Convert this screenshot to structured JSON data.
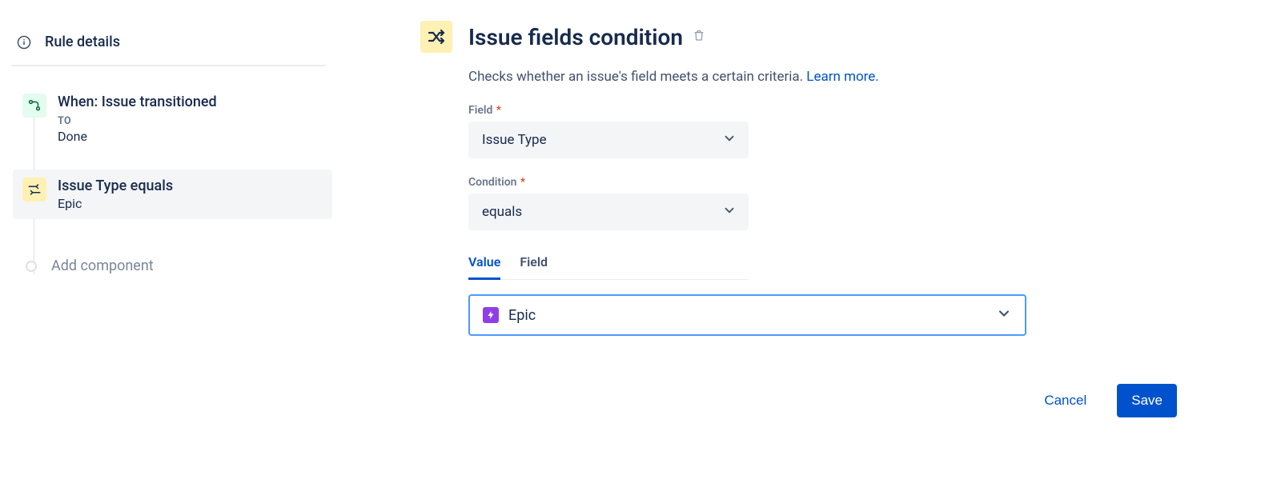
{
  "sidebar": {
    "rule_details_label": "Rule details",
    "steps": [
      {
        "title": "When: Issue transitioned",
        "sub_label": "TO",
        "sub_value": "Done"
      },
      {
        "title": "Issue Type equals",
        "sub_value": "Epic"
      }
    ],
    "add_component_label": "Add component"
  },
  "panel": {
    "title": "Issue fields condition",
    "description_text": "Checks whether an issue's field meets a certain criteria. ",
    "learn_more": "Learn more.",
    "field_label": "Field",
    "field_value": "Issue Type",
    "condition_label": "Condition",
    "condition_value": "equals",
    "tabs": {
      "value": "Value",
      "field": "Field"
    },
    "value_selected": "Epic",
    "cancel": "Cancel",
    "save": "Save"
  }
}
